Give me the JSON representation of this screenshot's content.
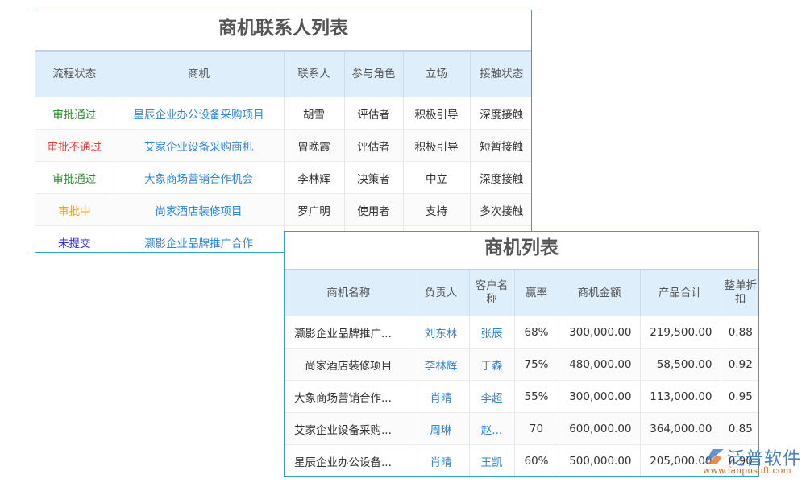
{
  "contacts_panel": {
    "title": "商机联系人列表",
    "columns": [
      "流程状态",
      "商机",
      "联系人",
      "参与角色",
      "立场",
      "接触状态"
    ],
    "rows": [
      {
        "status": "审批通过",
        "status_color": "#2d8a2d",
        "opportunity": "星辰企业办公设备采购项目",
        "contact": "胡雪",
        "role": "评估者",
        "stance": "积极引导",
        "contact_status": "深度接触"
      },
      {
        "status": "审批不通过",
        "status_color": "#f23a3a",
        "opportunity": "艾家企业设备采购商机",
        "contact": "曾晚霞",
        "role": "评估者",
        "stance": "积极引导",
        "contact_status": "短暂接触"
      },
      {
        "status": "审批通过",
        "status_color": "#2d8a2d",
        "opportunity": "大象商场营销合作机会",
        "contact": "李林辉",
        "role": "决策者",
        "stance": "中立",
        "contact_status": "深度接触"
      },
      {
        "status": "审批中",
        "status_color": "#f5a020",
        "opportunity": "尚家酒店装修项目",
        "contact": "罗广明",
        "role": "使用者",
        "stance": "支持",
        "contact_status": "多次接触"
      },
      {
        "status": "未提交",
        "status_color": "#2e2ed8",
        "opportunity": "灏影企业品牌推广合作",
        "contact": "",
        "role": "",
        "stance": "",
        "contact_status": ""
      }
    ]
  },
  "opportunities_panel": {
    "title": "商机列表",
    "columns": [
      "商机名称",
      "负责人",
      "客户名称",
      "赢率",
      "商机金额",
      "产品合计",
      "整单折扣"
    ],
    "rows": [
      {
        "name": "灏影企业品牌推广...",
        "owner": "刘东林",
        "customer": "张辰",
        "win_rate": "68%",
        "amount": "300,000.00",
        "product_total": "219,500.00",
        "discount": "0.88"
      },
      {
        "name": "尚家酒店装修项目",
        "owner": "李林辉",
        "customer": "于森",
        "win_rate": "75%",
        "amount": "480,000.00",
        "product_total": "58,500.00",
        "discount": "0.92"
      },
      {
        "name": "大象商场营销合作...",
        "owner": "肖晴",
        "customer": "李超",
        "win_rate": "55%",
        "amount": "300,000.00",
        "product_total": "113,000.00",
        "discount": "0.95"
      },
      {
        "name": "艾家企业设备采购...",
        "owner": "周琳",
        "customer": "赵...",
        "win_rate": "70",
        "amount": "600,000.00",
        "product_total": "364,000.00",
        "discount": "0.85"
      },
      {
        "name": "星辰企业办公设备...",
        "owner": "肖晴",
        "customer": "王凯",
        "win_rate": "60%",
        "amount": "500,000.00",
        "product_total": "205,000.00",
        "discount": "0.90"
      }
    ]
  },
  "watermark": {
    "brand": "泛普软件",
    "url": "www.fanpusoft.com"
  },
  "colors": {
    "border_accent": "#29a3d6",
    "header_bg": "#dfeefb",
    "link": "#2f86d8"
  }
}
